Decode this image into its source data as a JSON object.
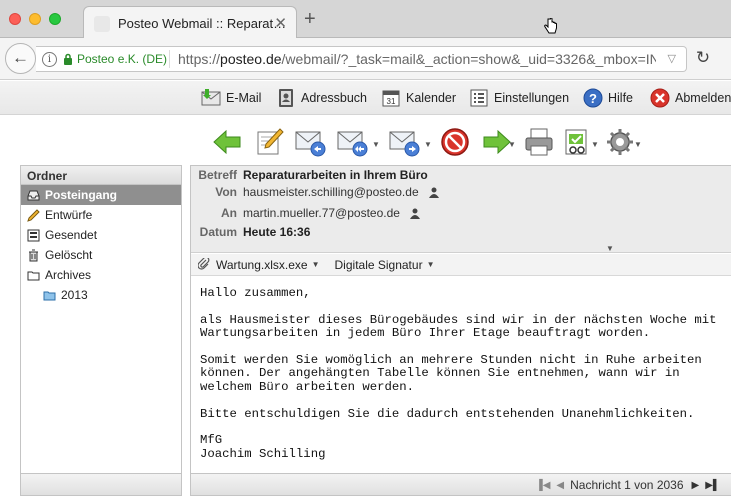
{
  "browser": {
    "tab_title": "Posteo Webmail :: Reparat…",
    "identity": "Posteo e.K. (DE)",
    "url_prefix": "https://",
    "url_host": "posteo.de",
    "url_path": "/webmail/?_task=mail&_action=show&_uid=3326&_mbox=INBOX&_ca"
  },
  "topnav": {
    "email": "E-Mail",
    "addressbook": "Adressbuch",
    "calendar": "Kalender",
    "settings": "Einstellungen",
    "help": "Hilfe",
    "logout": "Abmelden"
  },
  "colors": {
    "identity_green": "#2a8b2a",
    "active_folder_bg": "#8f8f8f",
    "header_bg": "#ebebeb"
  },
  "sidebar": {
    "header": "Ordner",
    "folders": [
      {
        "label": "Posteingang",
        "icon": "inbox-icon",
        "active": true
      },
      {
        "label": "Entwürfe",
        "icon": "pencil-icon"
      },
      {
        "label": "Gesendet",
        "icon": "sent-icon"
      },
      {
        "label": "Gelöscht",
        "icon": "trash-icon"
      },
      {
        "label": "Archives",
        "icon": "folder-icon"
      },
      {
        "label": "2013",
        "icon": "folder-icon"
      }
    ]
  },
  "message": {
    "subject_label": "Betreff",
    "subject": "Reparaturarbeiten in Ihrem Büro",
    "from_label": "Von",
    "from": "hausmeister.schilling@posteo.de",
    "to_label": "An",
    "to": "martin.mueller.77@posteo.de",
    "date_label": "Datum",
    "date": "Heute 16:36",
    "attachment": "Wartung.xlsx.exe",
    "signature": "Digitale Signatur",
    "body": "Hallo zusammen,\n\nals Hausmeister dieses Bürogebäudes sind wir in der nächsten Woche mit\nWartungsarbeiten in jedem Büro Ihrer Etage beauftragt worden.\n\nSomit werden Sie womöglich an mehrere Stunden nicht in Ruhe arbeiten\nkönnen. Der angehängten Tabelle können Sie entnehmen, wann wir in\nwelchem Büro arbeiten werden.\n\nBitte entschuldigen Sie die dadurch entstehenden Unanehmlichkeiten.\n\nMfG\nJoachim Schilling"
  },
  "pager": {
    "text": "Nachricht 1 von 2036"
  }
}
